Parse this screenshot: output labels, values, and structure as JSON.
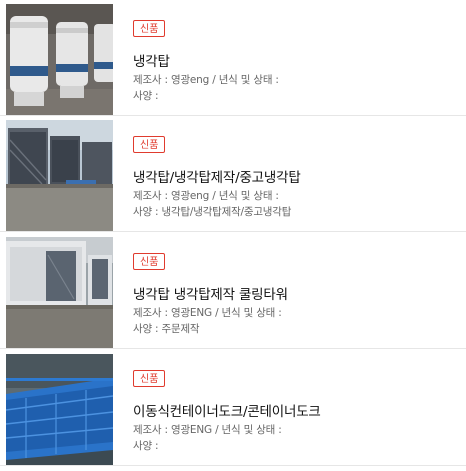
{
  "items": [
    {
      "badge": "신품",
      "title": "냉각탑",
      "maker_line": "제조사 : 영광eng / 년식 및 상태 :",
      "spec_line": "사양 :"
    },
    {
      "badge": "신품",
      "title": "냉각탑/냉각탑제작/중고냉각탑",
      "maker_line": "제조사 : 영광eng / 년식 및 상태 :",
      "spec_line": "사양 : 냉각탑/냉각탑제작/중고냉각탑"
    },
    {
      "badge": "신품",
      "title": "냉각탑 냉각탑제작 쿨링타워",
      "maker_line": "제조사 : 영광ENG / 년식 및 상태 :",
      "spec_line": "사양 : 주문제작"
    },
    {
      "badge": "신품",
      "title": "이동식컨테이너도크/콘테이너도크",
      "maker_line": "제조사 : 영광ENG / 년식 및 상태 :",
      "spec_line": "사양 :"
    }
  ]
}
